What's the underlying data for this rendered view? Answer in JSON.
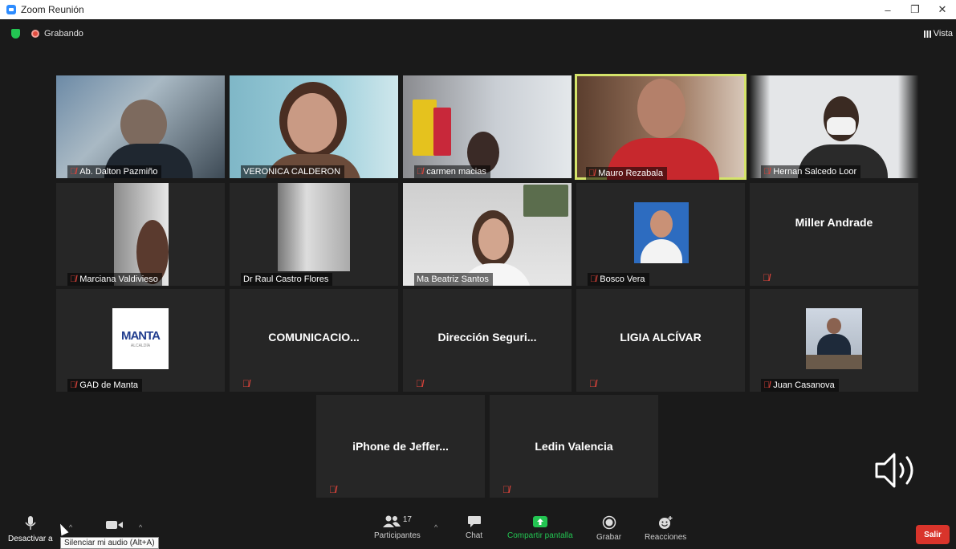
{
  "window": {
    "title": "Zoom Reunión",
    "minimize": "–",
    "maximize": "❐",
    "close": "✕"
  },
  "status": {
    "recording": "Grabando",
    "view": "Vista"
  },
  "participants": [
    {
      "name": "Ab. Dalton Pazmiño",
      "muted": true,
      "video": true
    },
    {
      "name": "VERONICA CALDERON",
      "muted": false,
      "video": true
    },
    {
      "name": "carmen macias",
      "muted": true,
      "video": true
    },
    {
      "name": "Mauro Rezabala",
      "muted": true,
      "video": true,
      "active": true
    },
    {
      "name": "Hernan Salcedo Loor",
      "muted": true,
      "video": true
    },
    {
      "name": "Marciana Valdivieso",
      "muted": true,
      "video": true
    },
    {
      "name": "Dr Raul Castro Flores",
      "muted": false,
      "video": true
    },
    {
      "name": "Ma Beatriz Santos",
      "muted": false,
      "video": true
    },
    {
      "name": "Bosco Vera",
      "muted": true,
      "video": false,
      "photo": true
    },
    {
      "name": "Miller Andrade",
      "muted": true,
      "video": false
    },
    {
      "name": "GAD de Manta",
      "muted": true,
      "video": false,
      "logo": "MANTA",
      "logo_sub": "ALCALDÍA"
    },
    {
      "name": "COMUNICACIO...",
      "muted": true,
      "video": false
    },
    {
      "name": "Dirección Seguri...",
      "muted": true,
      "video": false
    },
    {
      "name": "LIGIA ALCÍVAR",
      "muted": true,
      "video": false
    },
    {
      "name": "Juan Casanova",
      "muted": true,
      "video": false,
      "photo": true
    },
    {
      "name": "iPhone de Jeffer...",
      "muted": true,
      "video": false
    },
    {
      "name": "Ledin Valencia",
      "muted": true,
      "video": false
    }
  ],
  "toolbar": {
    "mute_label": "Desactivar a",
    "mute_tooltip": "Silenciar mi audio (Alt+A)",
    "participants_label": "Participantes",
    "participants_count": "17",
    "chat_label": "Chat",
    "share_label": "Compartir pantalla",
    "record_label": "Grabar",
    "reactions_label": "Reacciones",
    "leave_label": "Salir"
  },
  "colors": {
    "share_green": "#23c552",
    "leave_red": "#d9342b",
    "active_border": "#d4e36a",
    "muted_red": "#e0443b"
  }
}
